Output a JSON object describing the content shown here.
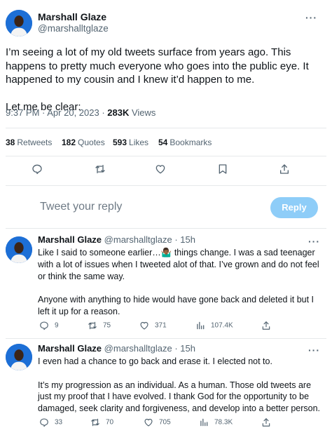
{
  "colors": {
    "accent": "#1d9bf0",
    "reply_button": "#8ecdf8",
    "secondary_text": "#536471",
    "avatar_bg": "#1d6fd6"
  },
  "main_tweet": {
    "author_name": "Marshall Glaze",
    "author_handle": "@marshalltglaze",
    "text": "I’m seeing a lot of my old tweets surface from years ago. This happens to pretty much everyone who goes into the public eye. It happened to my cousin and I knew it’d happen to me.\n\nLet me be clear:",
    "time": "9:37 PM",
    "date": "Apr 20, 2023",
    "views_count": "283K",
    "views_label": "Views",
    "stats": {
      "retweets_count": "38",
      "retweets_label": "Retweets",
      "quotes_count": "182",
      "quotes_label": "Quotes",
      "likes_count": "593",
      "likes_label": "Likes",
      "bookmarks_count": "54",
      "bookmarks_label": "Bookmarks"
    },
    "actions": [
      "reply-icon",
      "retweet-icon",
      "like-icon",
      "bookmark-icon",
      "share-icon"
    ]
  },
  "reply_composer": {
    "placeholder": "Tweet your reply",
    "button_label": "Reply"
  },
  "replies": [
    {
      "author_name": "Marshall Glaze",
      "author_handle": "@marshalltglaze",
      "time_ago": "15h",
      "text": "Like I said to someone earlier…🤷🏾‍♂️ things change. I was a sad teenager with a lot of issues when I tweeted alot of that. I’ve grown and do not feel or think the same way.\n\nAnyone with anything to hide would have gone back and deleted it but I left it up for a reason.",
      "replies_count": "9",
      "retweets_count": "75",
      "likes_count": "371",
      "views_count": "107.4K"
    },
    {
      "author_name": "Marshall Glaze",
      "author_handle": "@marshalltglaze",
      "time_ago": "15h",
      "text": "I even had a chance to go back and erase it. I elected not to.\n\nIt’s my progression as an individual. As a human. Those old tweets are just my proof that I have evolved. I thank God for the opportunity to be damaged, seek clarity and forgiveness, and develop into a better person.",
      "replies_count": "33",
      "retweets_count": "70",
      "likes_count": "705",
      "views_count": "78.3K"
    }
  ]
}
